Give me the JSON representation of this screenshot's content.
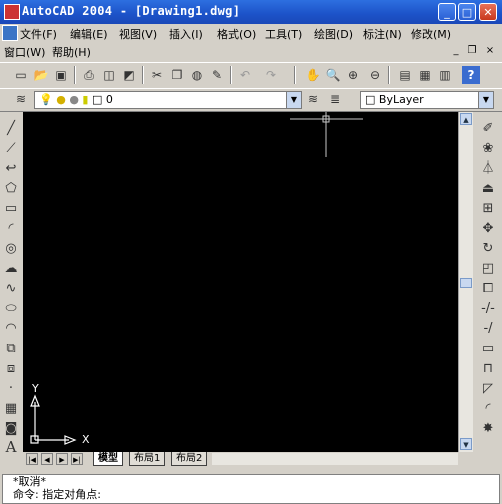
{
  "window": {
    "title": "AutoCAD 2004 - [Drawing1.dwg]",
    "btn_min": "_",
    "btn_max": "□",
    "btn_close": "✕"
  },
  "menubar": {
    "items": [
      "文件(F)",
      "编辑(E)",
      "视图(V)",
      "插入(I)",
      "格式(O)",
      "工具(T)",
      "绘图(D)",
      "标注(N)",
      "修改(M)"
    ],
    "items2": [
      "窗口(W)",
      "帮助(H)"
    ]
  },
  "doc_controls": {
    "min": "_",
    "restore": "❐",
    "close": "×"
  },
  "layers": {
    "current_layer": "0",
    "color_control": "ByLayer"
  },
  "tabs": [
    "模型",
    "布局1",
    "布局2"
  ],
  "ucs": {
    "x_label": "X",
    "y_label": "Y"
  },
  "command": {
    "line1": "*取消*",
    "line2": "命令: 指定对角点:"
  },
  "icons": {
    "standard": [
      "new-icon",
      "open-icon",
      "save-icon",
      "print-icon",
      "preview-icon",
      "publish-icon",
      "cut-icon",
      "copy-icon",
      "paste-icon",
      "matchprop-icon",
      "undo-icon",
      "redo-icon",
      "pan-icon",
      "zoom-realtime-icon",
      "zoom-window-icon",
      "zoom-previous-icon",
      "properties-icon",
      "designcenter-icon",
      "toolpalettes-icon",
      "help-icon"
    ],
    "draw": [
      "line-icon",
      "construction-line-icon",
      "polyline-icon",
      "polygon-icon",
      "rectangle-icon",
      "arc-icon",
      "circle-icon",
      "revcloud-icon",
      "spline-icon",
      "ellipse-icon",
      "ellipse-arc-icon",
      "insert-block-icon",
      "make-block-icon",
      "point-icon",
      "hatch-icon",
      "region-icon",
      "text-icon"
    ],
    "modify": [
      "erase-icon",
      "copy-object-icon",
      "mirror-icon",
      "offset-icon",
      "array-icon",
      "move-icon",
      "rotate-icon",
      "scale-icon",
      "stretch-icon",
      "trim-icon",
      "extend-icon",
      "break-icon",
      "join-icon",
      "chamfer-icon",
      "fillet-icon",
      "explode-icon"
    ]
  }
}
